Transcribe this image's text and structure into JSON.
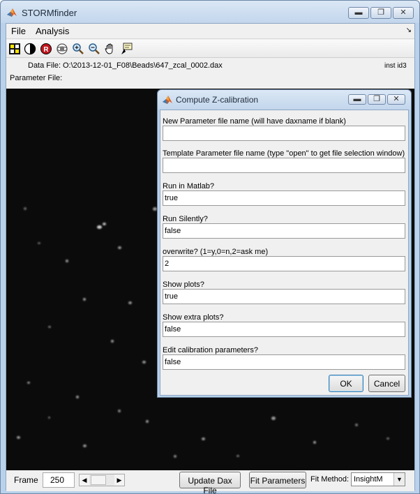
{
  "window": {
    "title": "STORMfinder"
  },
  "menu": {
    "items": [
      "File",
      "Analysis"
    ]
  },
  "toolbar": {
    "tools": [
      "data-cursor-icon",
      "contrast-icon",
      "record-icon",
      "rotate-3d-icon",
      "zoom-in-icon",
      "zoom-out-icon",
      "pan-hand-icon",
      "data-tip-icon"
    ]
  },
  "info": {
    "data_file_label": "Data File:",
    "data_file_value": "O:\\2013-12-01_F08\\Beads\\647_zcal_0002.dax",
    "inst_id": "inst id3",
    "parameter_file_label": "Parameter File:"
  },
  "bottom": {
    "frame_label": "Frame",
    "frame_value": "250",
    "update_button": "Update Dax File",
    "fit_button": "Fit Parameters",
    "fit_method_label": "Fit Method:",
    "fit_method_value": "InsightM"
  },
  "dialog": {
    "title": "Compute Z-calibration",
    "fields": [
      {
        "label": "New Parameter file name (will have daxname if blank)",
        "value": ""
      },
      {
        "label": "Template Parameter file name (type \"open\" to get file selection window)",
        "value": ""
      },
      {
        "label": "Run in Matlab?",
        "value": "true"
      },
      {
        "label": "Run Silently?",
        "value": "false"
      },
      {
        "label": "overwrite? (1=y,0=n,2=ask me)",
        "value": "2"
      },
      {
        "label": "Show plots?",
        "value": "true"
      },
      {
        "label": "Show extra plots?",
        "value": "false"
      },
      {
        "label": "Edit calibration parameters?",
        "value": "false"
      }
    ],
    "ok_label": "OK",
    "cancel_label": "Cancel"
  }
}
